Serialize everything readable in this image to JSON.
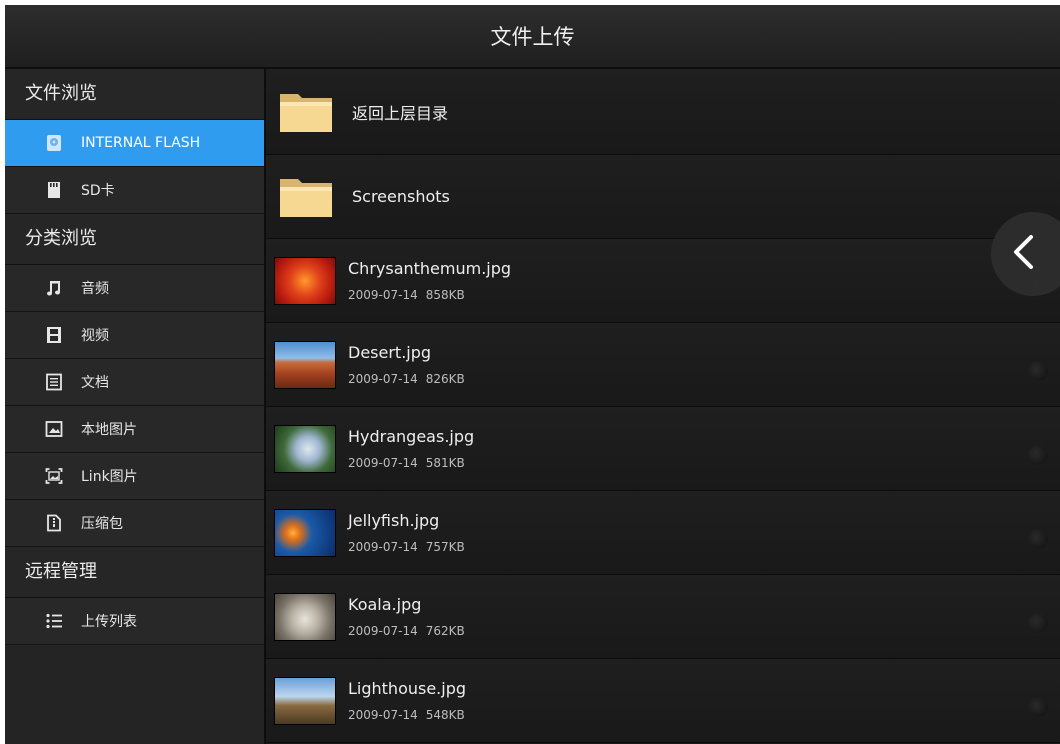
{
  "title": "文件上传",
  "sidebar": {
    "browse_header": "文件浏览",
    "storage": [
      {
        "label": "INTERNAL FLASH",
        "icon": "internal-flash-icon",
        "active": true
      },
      {
        "label": "SD卡",
        "icon": "sd-card-icon",
        "active": false
      }
    ],
    "category_header": "分类浏览",
    "categories": [
      {
        "label": "音频",
        "icon": "music-note-icon"
      },
      {
        "label": "视频",
        "icon": "film-icon"
      },
      {
        "label": "文档",
        "icon": "document-icon"
      },
      {
        "label": "本地图片",
        "icon": "image-icon"
      },
      {
        "label": "Link图片",
        "icon": "link-image-icon"
      },
      {
        "label": "压缩包",
        "icon": "archive-icon"
      }
    ],
    "remote_header": "远程管理",
    "remote": [
      {
        "label": "上传列表",
        "icon": "list-icon"
      }
    ]
  },
  "list": {
    "folders": [
      {
        "name": "返回上层目录",
        "icon": "folder-icon"
      },
      {
        "name": "Screenshots",
        "icon": "folder-icon"
      }
    ],
    "files": [
      {
        "name": "Chrysanthemum.jpg",
        "date": "2009-07-14",
        "size": "858KB"
      },
      {
        "name": "Desert.jpg",
        "date": "2009-07-14",
        "size": "826KB"
      },
      {
        "name": "Hydrangeas.jpg",
        "date": "2009-07-14",
        "size": "581KB"
      },
      {
        "name": "Jellyfish.jpg",
        "date": "2009-07-14",
        "size": "757KB"
      },
      {
        "name": "Koala.jpg",
        "date": "2009-07-14",
        "size": "762KB"
      },
      {
        "name": "Lighthouse.jpg",
        "date": "2009-07-14",
        "size": "548KB"
      }
    ]
  },
  "colors": {
    "accent": "#2f9cf0",
    "folder": "#f3d08a",
    "background": "#1b1b1b"
  },
  "back_handle_icon": "chevron-left-icon"
}
